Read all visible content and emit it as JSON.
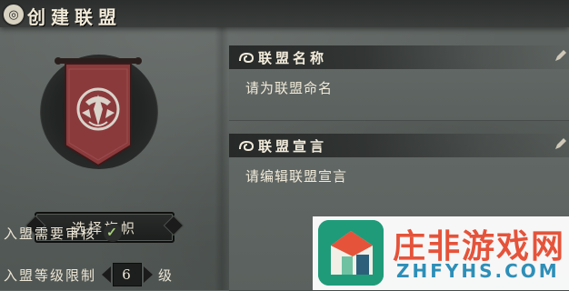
{
  "header": {
    "title": "创建联盟",
    "title_icon": "shield-badge-icon",
    "close_icon": "close-icon"
  },
  "left_panel": {
    "banner": {
      "icon": "alliance-banner-icon",
      "colors": {
        "banner": "#8b3a3c",
        "emblem": "#cfc9c0"
      }
    },
    "select_banner_button": "选择旗帜",
    "require_review": {
      "label": "入盟需要审核",
      "checked": true
    },
    "level_limit": {
      "label": "入盟等级限制",
      "value": "6",
      "unit": "级"
    }
  },
  "fields": [
    {
      "label": "联盟名称",
      "placeholder": "请为联盟命名"
    },
    {
      "label": "联盟宣言",
      "placeholder": "请编辑联盟宣言"
    }
  ],
  "watermark": {
    "title": "庄非游戏网",
    "subtitle": "ZHFYHS.COM",
    "colors": {
      "title": "#e5533a",
      "subtitle": "#2d8fb8",
      "logo": "#1f9b7a"
    }
  }
}
